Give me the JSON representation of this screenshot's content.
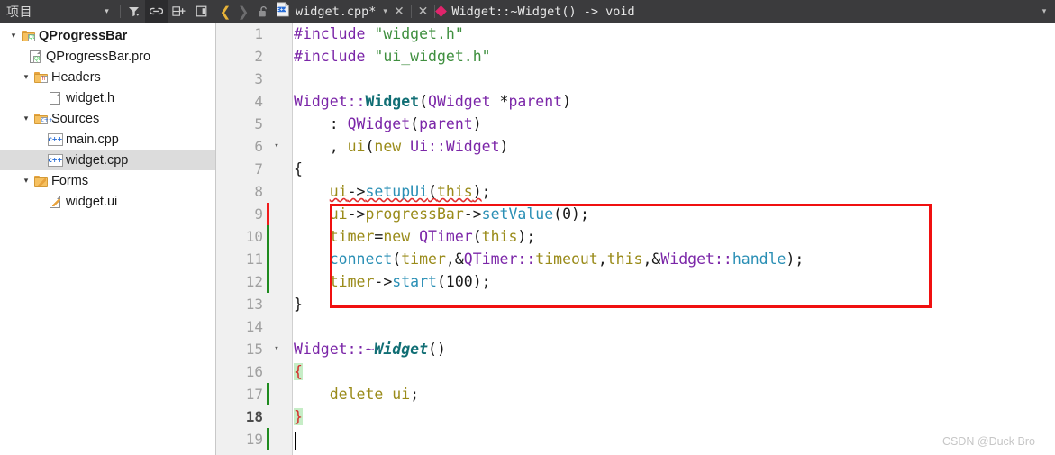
{
  "project_panel": {
    "title": "项目",
    "tools": [
      {
        "name": "project-dropdown-arrow",
        "glyph": "▾"
      },
      {
        "name": "filter-icon",
        "glyph": "filter"
      },
      {
        "name": "link-icon",
        "glyph": "link"
      },
      {
        "name": "split-add-icon",
        "glyph": "split-add"
      },
      {
        "name": "close-panel-icon",
        "glyph": "close-panel"
      }
    ],
    "tree": [
      {
        "label": "QProgressBar",
        "indent": 0,
        "chevron": "▾",
        "icon": "folder-qt",
        "bold": true,
        "selected": false
      },
      {
        "label": "QProgressBar.pro",
        "indent": 1,
        "chevron": "",
        "icon": "doc-qt",
        "bold": false,
        "selected": false
      },
      {
        "label": "Headers",
        "indent": 1,
        "chevron": "▾",
        "icon": "folder-h",
        "bold": false,
        "selected": false
      },
      {
        "label": "widget.h",
        "indent": 2,
        "chevron": "",
        "icon": "doc-plain",
        "bold": false,
        "selected": false
      },
      {
        "label": "Sources",
        "indent": 1,
        "chevron": "▾",
        "icon": "folder-cpp",
        "bold": false,
        "selected": false
      },
      {
        "label": "main.cpp",
        "indent": 2,
        "chevron": "",
        "icon": "cpp",
        "bold": false,
        "selected": false
      },
      {
        "label": "widget.cpp",
        "indent": 2,
        "chevron": "",
        "icon": "cpp",
        "bold": false,
        "selected": true
      },
      {
        "label": "Forms",
        "indent": 1,
        "chevron": "▾",
        "icon": "folder-ui",
        "bold": false,
        "selected": false
      },
      {
        "label": "widget.ui",
        "indent": 2,
        "chevron": "",
        "icon": "doc-ui",
        "bold": false,
        "selected": false
      }
    ]
  },
  "editor_bar": {
    "back_arrow": "❮",
    "forward_arrow": "❯",
    "lock_icon": "unlocked-padlock-icon",
    "file_icon": "cpp-file-icon",
    "file_name": "widget.cpp*",
    "file_dropdown_arrow": "▾",
    "close_file": "✕",
    "split_close": "✕",
    "symbol_marker": "method-diamond-icon",
    "symbol_name": "Widget::~Widget() -> void",
    "far_right_arrow": "▾"
  },
  "editor": {
    "lines": [
      {
        "n": "1",
        "fold": "",
        "vcs": "",
        "cur": false
      },
      {
        "n": "2",
        "fold": "",
        "vcs": "",
        "cur": false
      },
      {
        "n": "3",
        "fold": "",
        "vcs": "",
        "cur": false
      },
      {
        "n": "4",
        "fold": "",
        "vcs": "",
        "cur": false
      },
      {
        "n": "5",
        "fold": "",
        "vcs": "",
        "cur": false
      },
      {
        "n": "6",
        "fold": "▾",
        "vcs": "",
        "cur": false
      },
      {
        "n": "7",
        "fold": "",
        "vcs": "",
        "cur": false
      },
      {
        "n": "8",
        "fold": "",
        "vcs": "",
        "cur": false
      },
      {
        "n": "9",
        "fold": "",
        "vcs": "red",
        "cur": false
      },
      {
        "n": "10",
        "fold": "",
        "vcs": "green",
        "cur": false
      },
      {
        "n": "11",
        "fold": "",
        "vcs": "green",
        "cur": false
      },
      {
        "n": "12",
        "fold": "",
        "vcs": "green",
        "cur": false
      },
      {
        "n": "13",
        "fold": "",
        "vcs": "",
        "cur": false
      },
      {
        "n": "14",
        "fold": "",
        "vcs": "",
        "cur": false
      },
      {
        "n": "15",
        "fold": "▾",
        "vcs": "",
        "cur": false
      },
      {
        "n": "16",
        "fold": "",
        "vcs": "",
        "cur": false
      },
      {
        "n": "17",
        "fold": "",
        "vcs": "green",
        "cur": false
      },
      {
        "n": "18",
        "fold": "",
        "vcs": "",
        "cur": true
      },
      {
        "n": "19",
        "fold": "",
        "vcs": "green",
        "cur": false
      }
    ],
    "code_text": [
      "#include \"widget.h\"",
      "#include \"ui_widget.h\"",
      "",
      "Widget::Widget(QWidget *parent)",
      "    : QWidget(parent)",
      "    , ui(new Ui::Widget)",
      "{",
      "    ui->setupUi(this);",
      "    ui->progressBar->setValue(0);",
      "    timer=new QTimer(this);",
      "    connect(timer,&QTimer::timeout,this,&Widget::handle);",
      "    timer->start(100);",
      "}",
      "",
      "Widget::~Widget()",
      "{",
      "    delete ui;",
      "}",
      ""
    ],
    "annotation": {
      "name": "red-highlight-rectangle",
      "color": "#f01010",
      "covers_lines": "9-12"
    }
  },
  "watermark": {
    "text": "CSDN @Duck Bro"
  }
}
